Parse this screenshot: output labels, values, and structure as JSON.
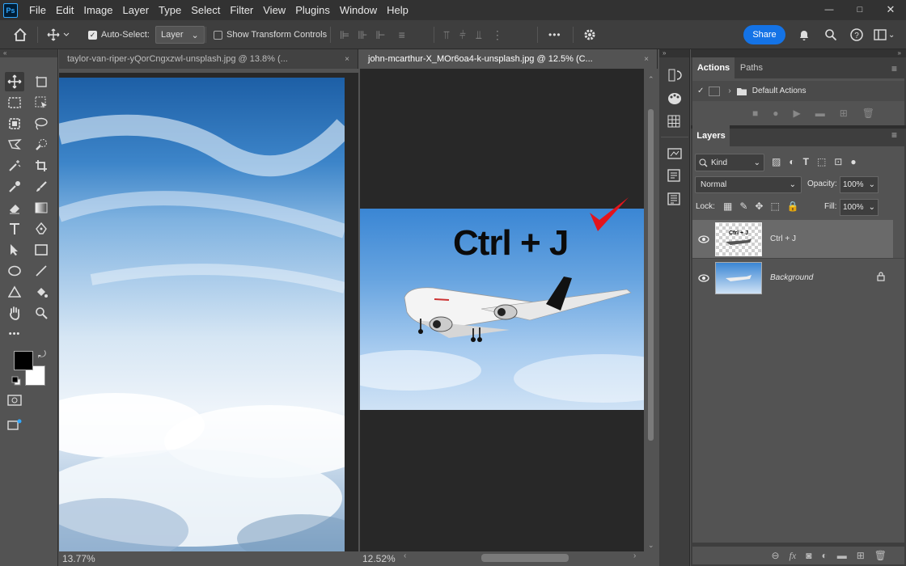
{
  "app": {
    "logo": "Ps"
  },
  "menu": [
    "File",
    "Edit",
    "Image",
    "Layer",
    "Type",
    "Select",
    "Filter",
    "View",
    "Plugins",
    "Window",
    "Help"
  ],
  "window_controls": {
    "minimize": "—",
    "maximize": "□",
    "close": "✕"
  },
  "options": {
    "auto_select_label": "Auto-Select:",
    "auto_select_target": "Layer",
    "transform_label": "Show Transform Controls",
    "more": "•••",
    "share_label": "Share"
  },
  "documents": [
    {
      "title": "taylor-van-riper-yQorCngxzwl-unsplash.jpg @ 13.8% (...",
      "zoom": "13.77%",
      "close": "×"
    },
    {
      "title": "john-mcarthur-X_MOr6oa4-k-unsplash.jpg @ 12.5% (C...",
      "zoom": "12.52%",
      "close": "×"
    }
  ],
  "canvas_overlay_text": "Ctrl + J",
  "toolbar": {
    "more": "•••"
  },
  "panels": {
    "actions_tabs": [
      "Actions",
      "Paths"
    ],
    "actions_set": "Default Actions",
    "layers_tab": "Layers",
    "filter_kind": "Kind",
    "blend_mode": "Normal",
    "opacity_label": "Opacity:",
    "opacity_value": "100%",
    "lock_label": "Lock:",
    "fill_label": "Fill:",
    "fill_value": "100%",
    "layers": [
      {
        "name": "Ctrl + J",
        "selected": true,
        "visible": true,
        "thumb_text": "Ctrl + J"
      },
      {
        "name": "Background",
        "selected": false,
        "visible": true,
        "locked": true
      }
    ]
  },
  "colors": {
    "accent": "#1473e6",
    "foreground": "#000000",
    "background": "#ffffff",
    "checkmark": "#e3141b"
  }
}
